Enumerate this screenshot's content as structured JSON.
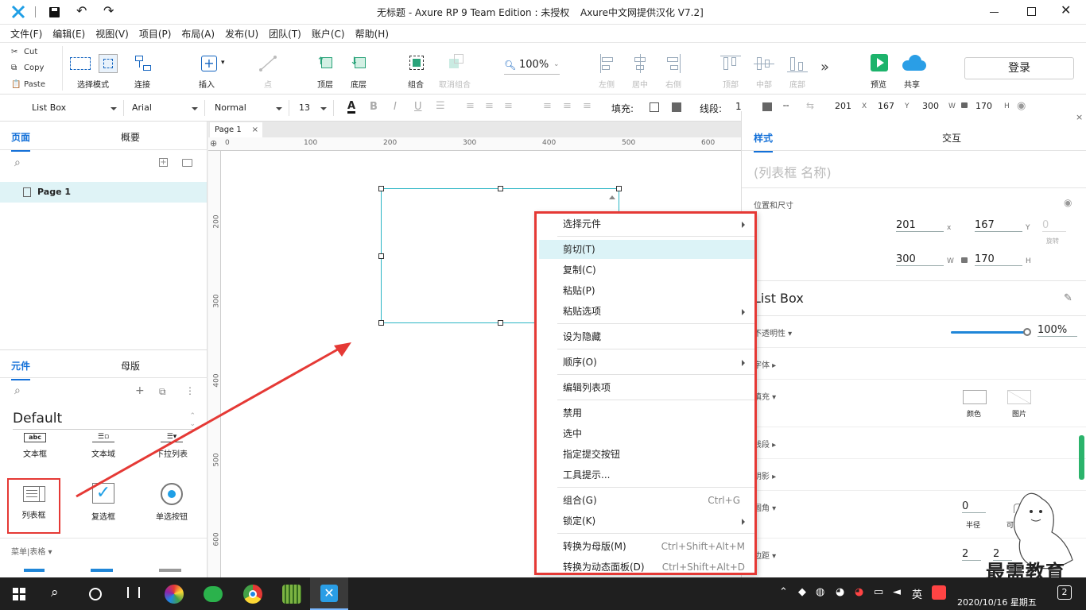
{
  "window": {
    "title": "无标题 - Axure RP 9 Team Edition : 未授权",
    "localization": "Axure中文网提供汉化 V7.2]"
  },
  "menu": [
    "文件(F)",
    "编辑(E)",
    "视图(V)",
    "项目(P)",
    "布局(A)",
    "发布(U)",
    "团队(T)",
    "账户(C)",
    "帮助(H)"
  ],
  "clipboard": {
    "cut": "Cut",
    "copy": "Copy",
    "paste": "Paste"
  },
  "toolbar": {
    "select_mode": "选择模式",
    "connect": "连接",
    "insert": "插入",
    "point": "点",
    "top": "顶层",
    "bottom": "底层",
    "group": "组合",
    "ungroup": "取消组合",
    "zoom": "100%",
    "align_left": "左侧",
    "align_center": "居中",
    "align_right": "右侧",
    "align_top": "顶部",
    "align_middle": "中部",
    "align_bottom": "底部",
    "more": "»",
    "preview": "预览",
    "share": "共享",
    "login": "登录"
  },
  "format": {
    "widget_type": "List Box",
    "font": "Arial",
    "style": "Normal",
    "size": "13",
    "fill_label": "填充:",
    "line_label": "线段:",
    "line_value": "1",
    "x": "201",
    "x_label": "X",
    "y": "167",
    "y_label": "Y",
    "w": "300",
    "w_label": "W",
    "h": "170",
    "h_label": "H"
  },
  "pages_panel": {
    "tab_pages": "页面",
    "tab_outline": "概要",
    "page_item": "Page 1"
  },
  "widgets_panel": {
    "tab_widgets": "元件",
    "tab_masters": "母版",
    "library": "Default",
    "row1": [
      "文本框",
      "文本域",
      "下拉列表"
    ],
    "row2": [
      "列表框",
      "复选框",
      "单选按钮"
    ],
    "section": "菜单|表格 ▾",
    "icon_text": "abc"
  },
  "canvas": {
    "tab": "Page 1",
    "ruler_h": [
      "0",
      "100",
      "200",
      "300",
      "400",
      "500",
      "600"
    ],
    "ruler_v": [
      "200",
      "300",
      "400",
      "500",
      "600"
    ]
  },
  "context_menu": [
    {
      "label": "选择元件",
      "sub": true
    },
    {
      "label": "剪切(T)",
      "highlight": true
    },
    {
      "label": "复制(C)"
    },
    {
      "label": "粘贴(P)"
    },
    {
      "label": "粘贴选项",
      "sub": true
    },
    {
      "label": "设为隐藏"
    },
    {
      "label": "顺序(O)",
      "sub": true
    },
    {
      "label": "编辑列表项"
    },
    {
      "label": "禁用"
    },
    {
      "label": "选中"
    },
    {
      "label": "指定提交按钮"
    },
    {
      "label": "工具提示..."
    },
    {
      "label": "组合(G)",
      "shortcut": "Ctrl+G"
    },
    {
      "label": "锁定(K)",
      "sub": true
    },
    {
      "label": "转换为母版(M)",
      "shortcut": "Ctrl+Shift+Alt+M"
    },
    {
      "label": "转换为动态面板(D)",
      "shortcut": "Ctrl+Shift+Alt+D"
    }
  ],
  "inspector": {
    "tab_style": "样式",
    "tab_interact": "交互",
    "name_placeholder": "(列表框 名称)",
    "pos_size": "位置和尺寸",
    "x": "201",
    "x_label": "x",
    "y": "167",
    "y_label": "Y",
    "rot": "0",
    "rot_label": "旋转",
    "w": "300",
    "w_label": "W",
    "h": "170",
    "h_label": "H",
    "widget_title": "List Box",
    "opacity_label": "不透明性 ▾",
    "opacity_value": "100%",
    "opacity_level": 1.0,
    "rows": [
      "字体 ▸",
      "填充 ▾",
      "线段 ▸",
      "阴影 ▸",
      "圆角 ▾",
      "边距 ▾"
    ],
    "fill_color": "颜色",
    "fill_image": "图片",
    "radius_value": "0",
    "radius_label": "半径",
    "visible_label": "可见性",
    "padding_a": "2",
    "padding_b": "2"
  },
  "taskbar": {
    "ime": "英",
    "date": "2020/10/16 星期五",
    "notifications": "2"
  },
  "watermark": "最需教育",
  "colors": {
    "accent": "#1370d8",
    "selection": "#2ab5c5",
    "annotation_red": "#e53935",
    "preview_green": "#1cb36b",
    "share_blue": "#2a9ee6"
  }
}
